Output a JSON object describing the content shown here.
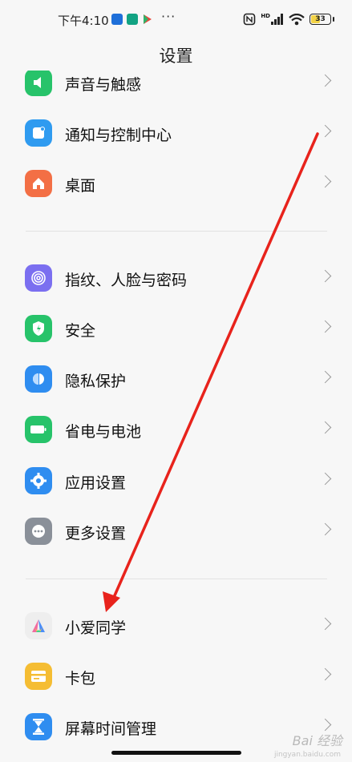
{
  "status_bar": {
    "time": "下午4:10",
    "dots": "···",
    "hd_label": "HD",
    "battery": "33",
    "colors": {
      "app1": "#1e6fd9",
      "app2": "#12a383",
      "app3_play": "#e9463a"
    }
  },
  "page": {
    "title": "设置"
  },
  "settings": [
    {
      "label": "声音与触感",
      "icon": "sound-icon",
      "color": "#27c36a"
    },
    {
      "label": "通知与控制中心",
      "icon": "notification-icon",
      "color": "#2f9bf0"
    },
    {
      "label": "桌面",
      "icon": "home-icon",
      "color": "#f36f45"
    },
    {
      "label": "指纹、人脸与密码",
      "icon": "fingerprint-icon",
      "color": "#7b6ff0"
    },
    {
      "label": "安全",
      "icon": "shield-icon",
      "color": "#27c36a"
    },
    {
      "label": "隐私保护",
      "icon": "privacy-icon",
      "color": "#2f8df0"
    },
    {
      "label": "省电与电池",
      "icon": "battery-icon",
      "color": "#27c36a"
    },
    {
      "label": "应用设置",
      "icon": "gear-icon",
      "color": "#2f8df0"
    },
    {
      "label": "更多设置",
      "icon": "more-icon",
      "color": "#8a9099"
    },
    {
      "label": "小爱同学",
      "icon": "xiaoai-icon",
      "color": "#eeeeee"
    },
    {
      "label": "卡包",
      "icon": "wallet-icon",
      "color": "#f5bd33"
    },
    {
      "label": "屏幕时间管理",
      "icon": "hourglass-icon",
      "color": "#2f8df0"
    }
  ],
  "watermark": {
    "text": "Bai 经验",
    "sub": "jingyan.baidu.com"
  },
  "annotation": {
    "arrow_color": "#e8231c"
  }
}
